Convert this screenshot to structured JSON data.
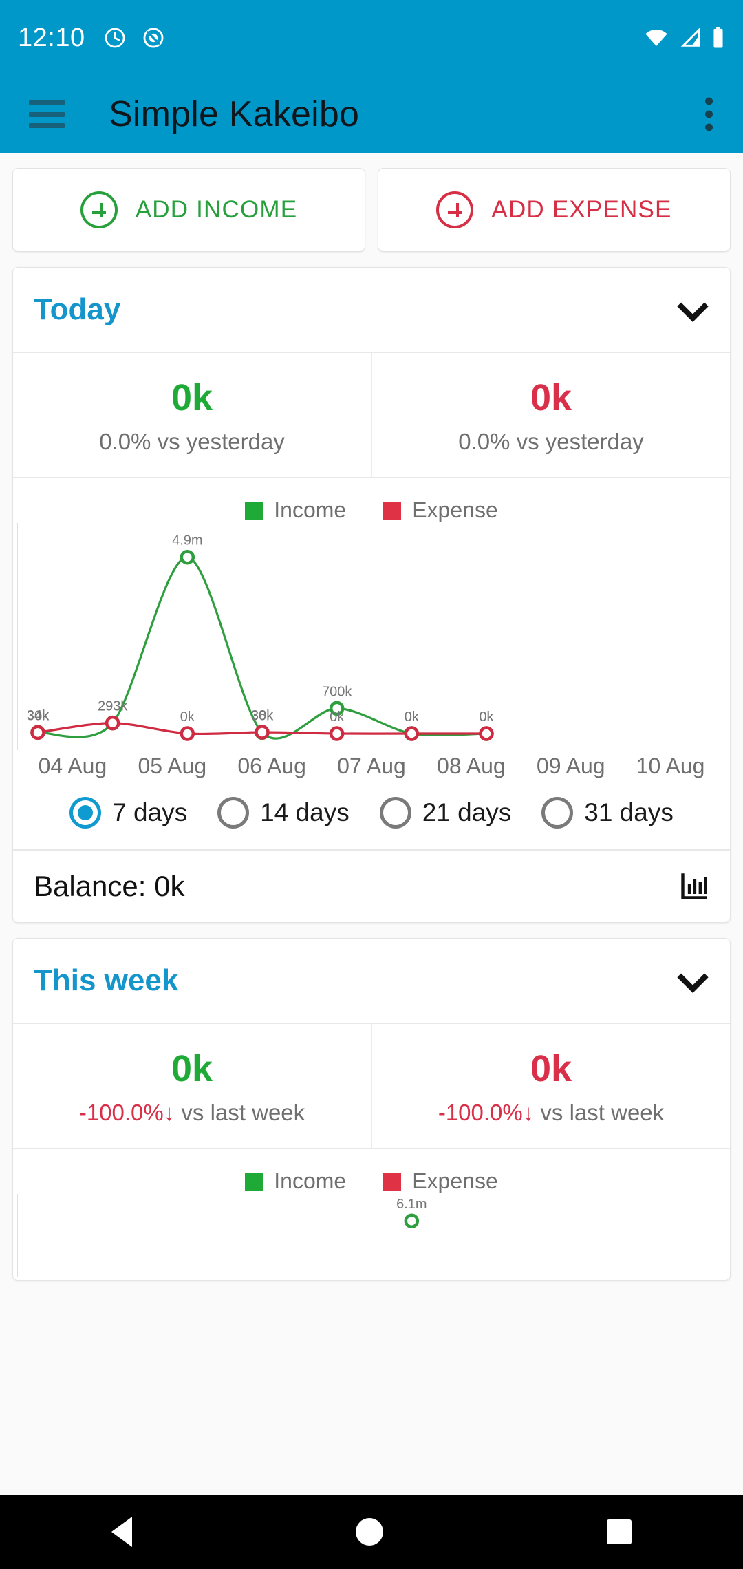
{
  "statusbar": {
    "time": "12:10",
    "icons": [
      "alarm-clock-icon",
      "do-not-disturb-icon"
    ],
    "right_icons": [
      "wifi-icon",
      "cellular-signal-icon",
      "battery-icon"
    ]
  },
  "appbar": {
    "menu_icon": "hamburger-menu-icon",
    "title": "Simple Kakeibo",
    "overflow_icon": "more-vertical-icon",
    "background": "#0098c9"
  },
  "actions": {
    "add_income": "ADD INCOME",
    "add_expense": "ADD EXPENSE",
    "income_color": "#27a03c",
    "expense_color": "#d62f45"
  },
  "cards": [
    {
      "title": "Today",
      "expand_icon": "chevron-down-icon",
      "stats": [
        {
          "value": "0k",
          "kind": "income",
          "sub": "0.0% vs yesterday",
          "delta": ""
        },
        {
          "value": "0k",
          "kind": "expense",
          "sub": "0.0% vs yesterday",
          "delta": ""
        }
      ],
      "legend": {
        "income": "Income",
        "expense": "Expense"
      },
      "ranges": [
        {
          "label": "7 days",
          "selected": true
        },
        {
          "label": "14 days",
          "selected": false
        },
        {
          "label": "21 days",
          "selected": false
        },
        {
          "label": "31 days",
          "selected": false
        }
      ],
      "balance": "Balance: 0k",
      "balance_icon": "bar-chart-icon"
    },
    {
      "title": "This week",
      "expand_icon": "chevron-down-icon",
      "stats": [
        {
          "value": "0k",
          "kind": "income",
          "sub": " vs last week",
          "delta": "-100.0%↓"
        },
        {
          "value": "0k",
          "kind": "expense",
          "sub": " vs last week",
          "delta": "-100.0%↓"
        }
      ],
      "legend": {
        "income": "Income",
        "expense": "Expense"
      }
    }
  ],
  "navbar": {
    "back": "back-icon",
    "home": "home-icon",
    "recents": "recents-icon"
  },
  "chart_data": [
    {
      "type": "line",
      "title": "",
      "categories": [
        "04 Aug",
        "05 Aug",
        "06 Aug",
        "07 Aug",
        "08 Aug",
        "09 Aug",
        "10 Aug"
      ],
      "series": [
        {
          "name": "Income",
          "color": "#2e9e3e",
          "values": [
            34000,
            293000,
            4900000,
            30000,
            700000,
            0,
            0
          ],
          "labels": [
            "34k",
            "293k",
            "4.9m",
            "30k",
            "700k",
            "0k",
            "0k"
          ]
        },
        {
          "name": "Expense",
          "color": "#cf2b42",
          "values": [
            30000,
            293000,
            0,
            38000,
            0,
            0,
            0
          ],
          "labels": [
            "30k",
            "293k",
            "0k",
            "38k",
            "0k",
            "0k",
            "0k"
          ]
        }
      ],
      "ylim": [
        0,
        5200000
      ],
      "grid": false,
      "legend_position": "top-center",
      "xlabel": "",
      "ylabel": ""
    },
    {
      "type": "line",
      "title": "",
      "categories": [],
      "series": [
        {
          "name": "Income",
          "color": "#2e9e3e",
          "values": [
            6100000
          ],
          "labels": [
            "6.1m"
          ]
        }
      ],
      "ylim": [
        0,
        6500000
      ],
      "grid": false,
      "legend_position": "top-center",
      "xlabel": "",
      "ylabel": ""
    }
  ]
}
